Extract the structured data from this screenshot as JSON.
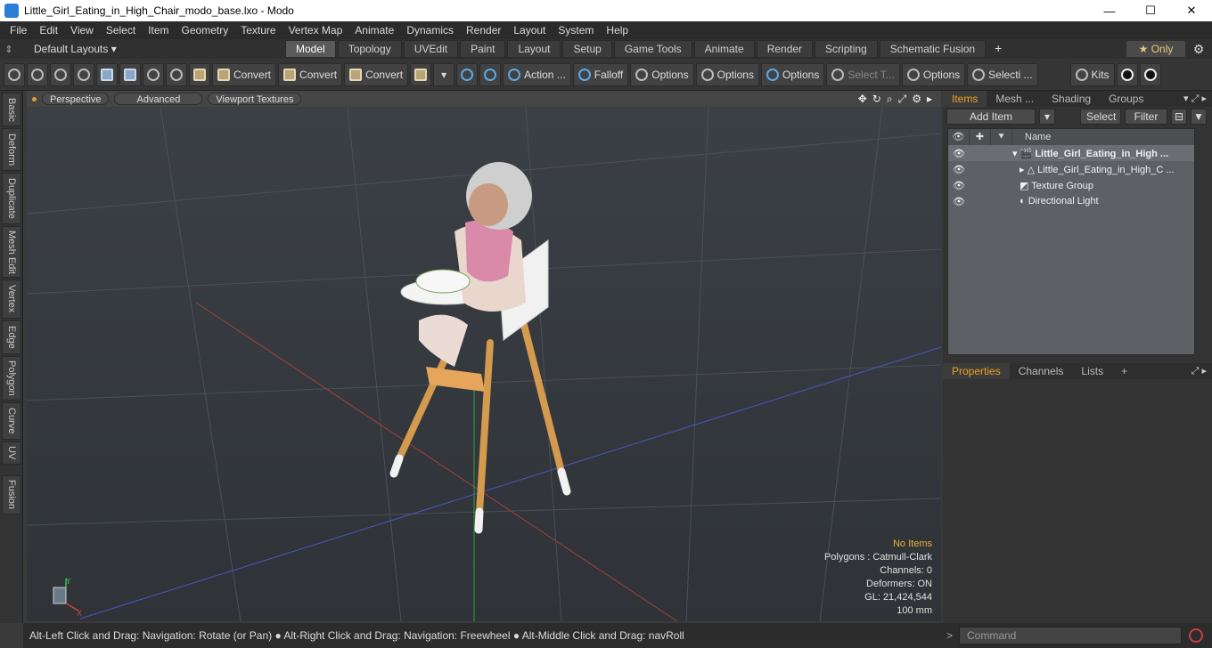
{
  "window": {
    "title": "Little_Girl_Eating_in_High_Chair_modo_base.lxo - Modo",
    "minimize": "—",
    "maximize": "☐",
    "close": "✕"
  },
  "menu": [
    "File",
    "Edit",
    "View",
    "Select",
    "Item",
    "Geometry",
    "Texture",
    "Vertex Map",
    "Animate",
    "Dynamics",
    "Render",
    "Layout",
    "System",
    "Help"
  ],
  "layout": {
    "grip": "⇕",
    "preset": "Default Layouts ▾",
    "tabs": [
      "Model",
      "Topology",
      "UVEdit",
      "Paint",
      "Layout",
      "Setup",
      "Game Tools",
      "Animate",
      "Render",
      "Scripting",
      "Schematic Fusion"
    ],
    "active_tab": "Model",
    "plus": "+",
    "only": "★  Only",
    "gear": "⚙"
  },
  "toolbar": {
    "convert1": "Convert",
    "convert2": "Convert",
    "convert3": "Convert",
    "action": "Action ...",
    "falloff": "Falloff",
    "options1": "Options",
    "options2": "Options",
    "options3": "Options",
    "select_t": "Select T...",
    "options4": "Options",
    "selecti": "Selecti ...",
    "kits": "Kits"
  },
  "left_tabs": [
    "Basic",
    "Deform",
    "Duplicate",
    "Mesh Edit",
    "Vertex",
    "Edge",
    "Polygon",
    "Curve",
    "UV",
    "Fusion"
  ],
  "viewport": {
    "perspective": "Perspective",
    "advanced": "Advanced",
    "textures": "Viewport Textures",
    "tools": [
      "✥",
      "↻",
      "⌕",
      "⤢",
      "⚙",
      "▸"
    ],
    "info": {
      "no_items": "No Items",
      "polygons": "Polygons : Catmull-Clark",
      "channels": "Channels: 0",
      "deformers": "Deformers: ON",
      "gl": "GL: 21,424,544",
      "scale": "100 mm"
    },
    "axis_y": "Y",
    "axis_x": "X"
  },
  "status": "Alt-Left Click and Drag: Navigation: Rotate (or Pan) ● Alt-Right Click and Drag: Navigation: Freewheel ● Alt-Middle Click and Drag: navRoll",
  "items_panel": {
    "tabs": [
      "Items",
      "Mesh ...",
      "Shading",
      "Groups"
    ],
    "controls": "▾ ⤢ ▸",
    "add_item": "Add Item",
    "dropdown": "▾",
    "select": "Select",
    "filter": "Filter",
    "header_name": "Name",
    "header_eye": "👁",
    "header_lock": "✚",
    "header_type": "⯆",
    "rows": [
      {
        "eye": "👁",
        "name": "▾ 🎬 Little_Girl_Eating_in_High ..."
      },
      {
        "eye": "👁",
        "name": "▸ △ Little_Girl_Eating_in_High_C ..."
      },
      {
        "eye": "👁",
        "name": "   ◩ Texture Group"
      },
      {
        "eye": "👁",
        "name": "   ◐ Directional Light"
      }
    ]
  },
  "props_panel": {
    "tabs": [
      "Properties",
      "Channels",
      "Lists"
    ],
    "plus": "+",
    "controls": "⤢ ▸"
  },
  "command": {
    "arrow": ">",
    "placeholder": "Command"
  }
}
